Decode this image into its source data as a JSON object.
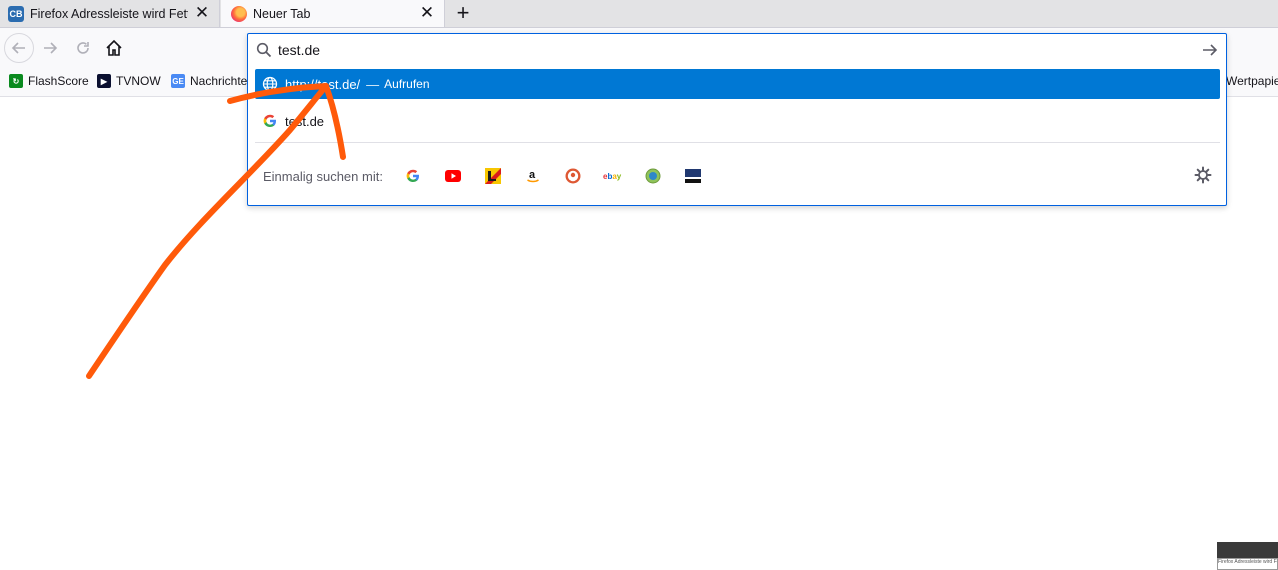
{
  "tabs": [
    {
      "title": "Firefox Adressleiste wird Fett be",
      "favicon": "computerbase-icon"
    },
    {
      "title": "Neuer Tab",
      "favicon": "firefox-icon"
    }
  ],
  "urlbar": {
    "value": "test.de"
  },
  "bookmarks": [
    {
      "label": "FlashScore",
      "icon": "flashscore-icon"
    },
    {
      "label": "TVNOW",
      "icon": "tvnow-icon"
    },
    {
      "label": "Nachrichte",
      "icon": "news-icon"
    },
    {
      "label": "Wertpapie",
      "icon": ""
    }
  ],
  "results": [
    {
      "text": "http://test.de/",
      "separator": "—",
      "action": "Aufrufen",
      "icon": "globe-icon",
      "selected": true
    },
    {
      "text": "test.de",
      "icon": "google-icon",
      "selected": false
    }
  ],
  "oneoff": {
    "label": "Einmalig suchen mit:",
    "engines": [
      "google-icon",
      "youtube-icon",
      "leo-icon",
      "amazon-icon",
      "duckduckgo-icon",
      "ebay-icon",
      "globe-engine-icon",
      "bar-engine-icon"
    ]
  },
  "thumbnail": {
    "text": "Firefox Adressleiste wird Fett"
  },
  "colors": {
    "selection": "#0078d4",
    "annotation": "#ff5a0a",
    "focus_border": "#0061e0"
  }
}
